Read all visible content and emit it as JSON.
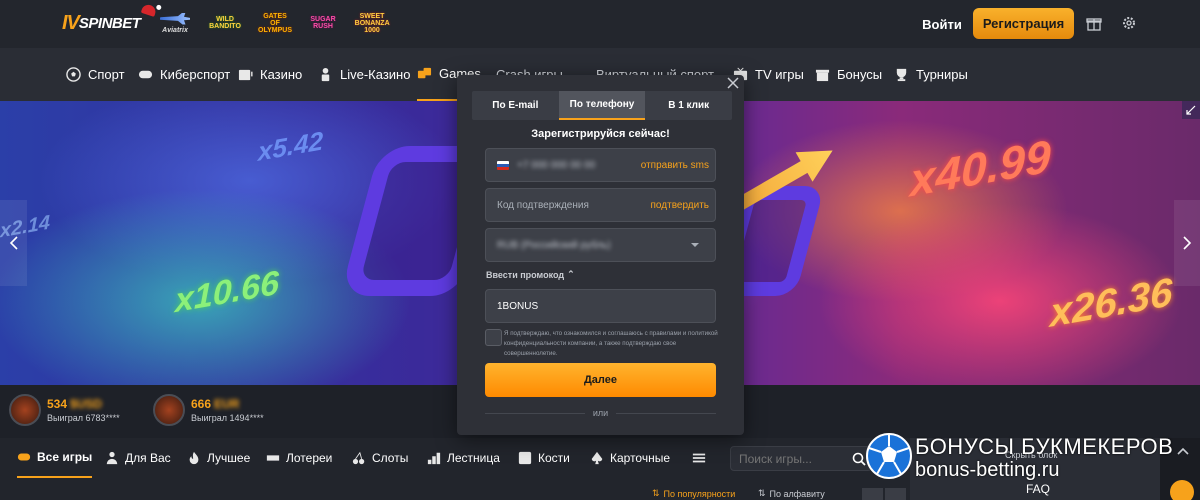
{
  "header": {
    "logo_prefix": "IV",
    "logo_text": "SPINBET",
    "games": [
      {
        "name": "aviator",
        "label": "Aviatrix"
      },
      {
        "name": "game-2",
        "label": "WILD BANDITO"
      },
      {
        "name": "game-3",
        "label": "GATES OF OLYMPUS"
      },
      {
        "name": "game-4",
        "label": "SUGAR RUSH"
      },
      {
        "name": "game-5",
        "label": "SWEET BONANZA 1000"
      }
    ],
    "login_label": "Войти",
    "register_label": "Регистрация"
  },
  "nav": {
    "items": [
      "Спорт",
      "Киберспорт",
      "Казино",
      "Live-Казино",
      "Games",
      "Crash игры",
      "Виртуальный спорт",
      "TV игры",
      "Бонусы",
      "Турниры"
    ]
  },
  "banner": {
    "multipliers": [
      "x5.42",
      "x2.14",
      "x10.66",
      "x40.99",
      "x26.36"
    ]
  },
  "winners": [
    {
      "amount": "534",
      "amount_hidden": "$USD",
      "who": "Выиграл 6783****"
    },
    {
      "amount": "666",
      "amount_hidden": "EUR",
      "who": "Выиграл 1494****"
    }
  ],
  "categories": [
    "Все игры",
    "Для Вас",
    "Лучшее",
    "Лотереи",
    "Слоты",
    "Лестница",
    "Кости",
    "Карточные"
  ],
  "search": {
    "placeholder": "Поиск игры..."
  },
  "sorting": {
    "popular": "По популярности",
    "alpha": "По алфавиту"
  },
  "sidebar": {
    "hide_block": "Скрыть блок",
    "faq": "FAQ"
  },
  "watermark": {
    "line1": "БОНУСЫ БУКМЕКЕРОВ",
    "line2": "bonus-betting.ru"
  },
  "modal": {
    "tabs": [
      "По E-mail",
      "По телефону",
      "В 1 клик"
    ],
    "active_tab": 1,
    "title": "Зарегистрируйся сейчас!",
    "phone_value": "+7 000 000 00 00",
    "send_sms": "отправить sms",
    "code_placeholder": "Код подтверждения",
    "confirm": "подтвердить",
    "currency_value": "RUB (Российский рубль)",
    "promo_toggle": "Ввести промокод",
    "promo_value": "1BONUS",
    "consent": "Я подтверждаю, что ознакомился и соглашаюсь с правилами и политикой конфиденциальности компании, а также подтверждаю свое совершеннолетие.",
    "next_label": "Далее",
    "or": "или"
  },
  "colors": {
    "accent": "#f7a21b",
    "background": "#1c1f26",
    "modal": "#2e3037"
  }
}
